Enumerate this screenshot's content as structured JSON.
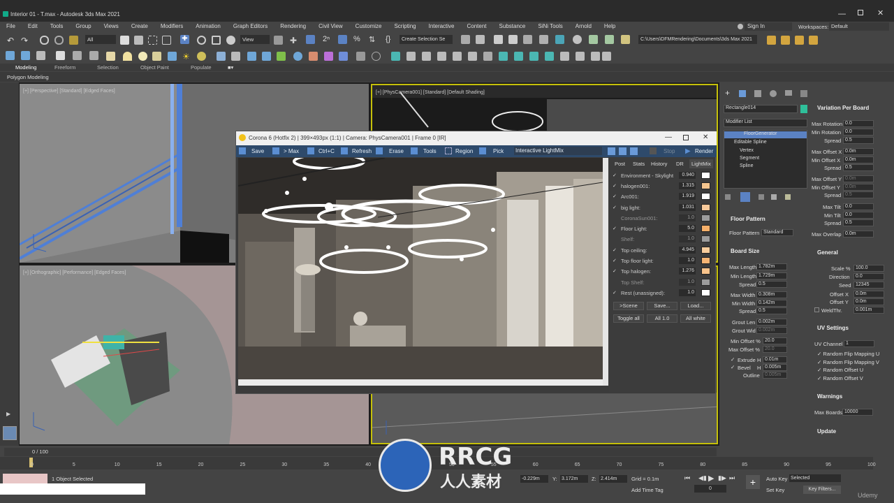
{
  "titlebar": {
    "title": "Interior 01 - T.max - Autodesk 3ds Max 2021"
  },
  "menu": [
    "File",
    "Edit",
    "Tools",
    "Group",
    "Views",
    "Create",
    "Modifiers",
    "Animation",
    "Graph Editors",
    "Rendering",
    "Civil View",
    "Customize",
    "Scripting",
    "Interactive",
    "Content",
    "Substance",
    "SiNi Tools",
    "Arnold",
    "Help"
  ],
  "account": {
    "sign_in": "Sign In",
    "workspaces_label": "Workspaces:",
    "workspace": "Default"
  },
  "toolbar": {
    "filter": "All",
    "view": "View",
    "selection_set": "Create Selection Se",
    "path": "C:\\Users\\DFMRendering\\Documents\\3ds Max 2021"
  },
  "ribbon": {
    "tabs": [
      "Modeling",
      "Freeform",
      "Selection",
      "Object Paint",
      "Populate"
    ],
    "sub": "Polygon Modeling"
  },
  "viewports": {
    "vp1": "[+] [Perspective] [Standard] [Edged Faces]",
    "vp2": "[+] [PhysCamera001] [Standard] [Default Shading]",
    "vp3": "[+] [Orthographic] [Performance] [Edged Faces]"
  },
  "vfb": {
    "title": "Corona 6 (Hotfix 2) | 399×493px (1:1) | Camera: PhysCamera001 | Frame 0 [IR]",
    "buttons": {
      "save": "Save",
      "max": "> Max",
      "ctrlc": "Ctrl+C",
      "refresh": "Refresh",
      "erase": "Erase",
      "tools": "Tools",
      "region": "Region",
      "pick": "Pick",
      "mode": "Interactive LightMix",
      "stop": "Stop",
      "render": "Render"
    },
    "tabs": [
      "Post",
      "Stats",
      "History",
      "DR",
      "LightMix"
    ],
    "lightmix": [
      {
        "on": true,
        "name": "Environment - Skylight",
        "value": "0.940",
        "color": "#ffffff"
      },
      {
        "on": true,
        "name": "halogen001:",
        "value": "1.315",
        "color": "#f5c58e"
      },
      {
        "on": true,
        "name": "Arc001:",
        "value": "1.919",
        "color": "#ffffff"
      },
      {
        "on": true,
        "name": "big light:",
        "value": "1.031",
        "color": "#f8c99a"
      },
      {
        "on": false,
        "name": "CoronaSun001:",
        "value": "1.0",
        "color": "#dcdcdc"
      },
      {
        "on": true,
        "name": "Floor Light:",
        "value": "5.0",
        "color": "#f6b06a"
      },
      {
        "on": false,
        "name": "Shelf:",
        "value": "1.0",
        "color": "#dcdcdc"
      },
      {
        "on": true,
        "name": "Top ceiling:",
        "value": "4.945",
        "color": "#f8cd9c"
      },
      {
        "on": true,
        "name": "Top floor light:",
        "value": "1.0",
        "color": "#f6b574"
      },
      {
        "on": true,
        "name": "Top halogen:",
        "value": "1.276",
        "color": "#f8c38b"
      },
      {
        "on": false,
        "name": "Top Shelf:",
        "value": "1.0",
        "color": "#dcdcdc"
      },
      {
        "on": true,
        "name": "Rest (unassigned):",
        "value": "1.0",
        "color": "#ffffff"
      }
    ],
    "lm_buttons": {
      "scene": ">Scene",
      "save": "Save...",
      "load": "Load...",
      "toggle": "Toggle all",
      "all1": "All 1.0",
      "allwhite": "All white"
    }
  },
  "cmd": {
    "object_name": "Rectangle014",
    "modifier_list": "Modifier List",
    "stack": [
      "FloorGenerator",
      "Editable Spline",
      "Vertex",
      "Segment",
      "Spline"
    ],
    "floor_pattern": {
      "header": "Floor Pattern",
      "label": "Floor Pattern",
      "value": "Standard"
    },
    "board_size": {
      "header": "Board Size",
      "rows": [
        {
          "label": "Max Length",
          "value": "1.782m"
        },
        {
          "label": "Min Length",
          "value": "1.729m"
        },
        {
          "label": "Spread",
          "value": "0.5"
        },
        {
          "label": "Max Width",
          "value": "0.308m"
        },
        {
          "label": "Min Width",
          "value": "0.142m"
        },
        {
          "label": "Spread",
          "value": "0.5"
        },
        {
          "label": "Grout Len",
          "value": "0.002m"
        },
        {
          "label": "Grout Wid",
          "value": "0.002m"
        },
        {
          "label": "Min Offset %",
          "value": "20.0"
        },
        {
          "label": "Max Offset %",
          "value": "20.0"
        }
      ],
      "extrude": {
        "label": "Extrude",
        "h": "H",
        "value": "0.01m"
      },
      "bevel": {
        "label": "Bevel",
        "h": "H",
        "value": "0.005m"
      },
      "outline": {
        "label": "Outline",
        "value": "0.005m"
      }
    },
    "variation": {
      "header": "Variation Per Board",
      "rows": [
        {
          "label": "Max Rotation",
          "value": "0.0"
        },
        {
          "label": "Min Rotation",
          "value": "0.0"
        },
        {
          "label": "Spread",
          "value": "0.5"
        },
        {
          "label": "Max Offset X",
          "value": "0.0m"
        },
        {
          "label": "Min Offset X",
          "value": "0.0m"
        },
        {
          "label": "Spread",
          "value": "0.5"
        },
        {
          "label": "Max Offset Y",
          "value": "0.0m"
        },
        {
          "label": "Min Offset Y",
          "value": "0.0m"
        },
        {
          "label": "Spread",
          "value": "0.5"
        },
        {
          "label": "Max Tilt",
          "value": "0.0"
        },
        {
          "label": "Min Tilt",
          "value": "0.0"
        },
        {
          "label": "Spread",
          "value": "0.5"
        },
        {
          "label": "Max Overlap",
          "value": "0.0m"
        }
      ]
    },
    "general": {
      "header": "General",
      "rows": [
        {
          "label": "Scale %",
          "value": "100.0"
        },
        {
          "label": "Direction",
          "value": "0.0"
        },
        {
          "label": "Seed",
          "value": "12345"
        },
        {
          "label": "Offset X",
          "value": "0.0m"
        },
        {
          "label": "Offset Y",
          "value": "0.0m"
        },
        {
          "label": "WeldThr.",
          "value": "0.001m"
        }
      ]
    },
    "uv": {
      "header": "UV Settings",
      "channel_label": "UV Channel",
      "channel": "1",
      "checks": [
        "Random Flip Mapping U",
        "Random Flip Mapping V",
        "Random Offset U",
        "Random Offset V"
      ]
    },
    "warnings": {
      "header": "Warnings",
      "label": "Max Boards",
      "value": "10000"
    },
    "update": {
      "header": "Update"
    }
  },
  "timeline": {
    "frame": "0 / 100",
    "ticks": [
      "0",
      "5",
      "10",
      "15",
      "20",
      "25",
      "30",
      "35",
      "40",
      "45",
      "50",
      "55",
      "60",
      "65",
      "70",
      "75",
      "80",
      "85",
      "90",
      "95",
      "100"
    ]
  },
  "status": {
    "selected": "1 Object Selected",
    "x": "-0.229m",
    "y_label": "Y:",
    "y": "3.172m",
    "z_label": "Z:",
    "z": "2.414m",
    "grid": "Grid = 0.1m",
    "add_time_tag": "Add Time Tag",
    "auto_key": "Auto Key",
    "set_key": "Set Key",
    "selected_dd": "Selected",
    "key_filters": "Key Filters...",
    "frame_field": "0"
  },
  "watermark": {
    "brand": "RRCG",
    "sub": "人人素材",
    "corner": "Udemy"
  }
}
